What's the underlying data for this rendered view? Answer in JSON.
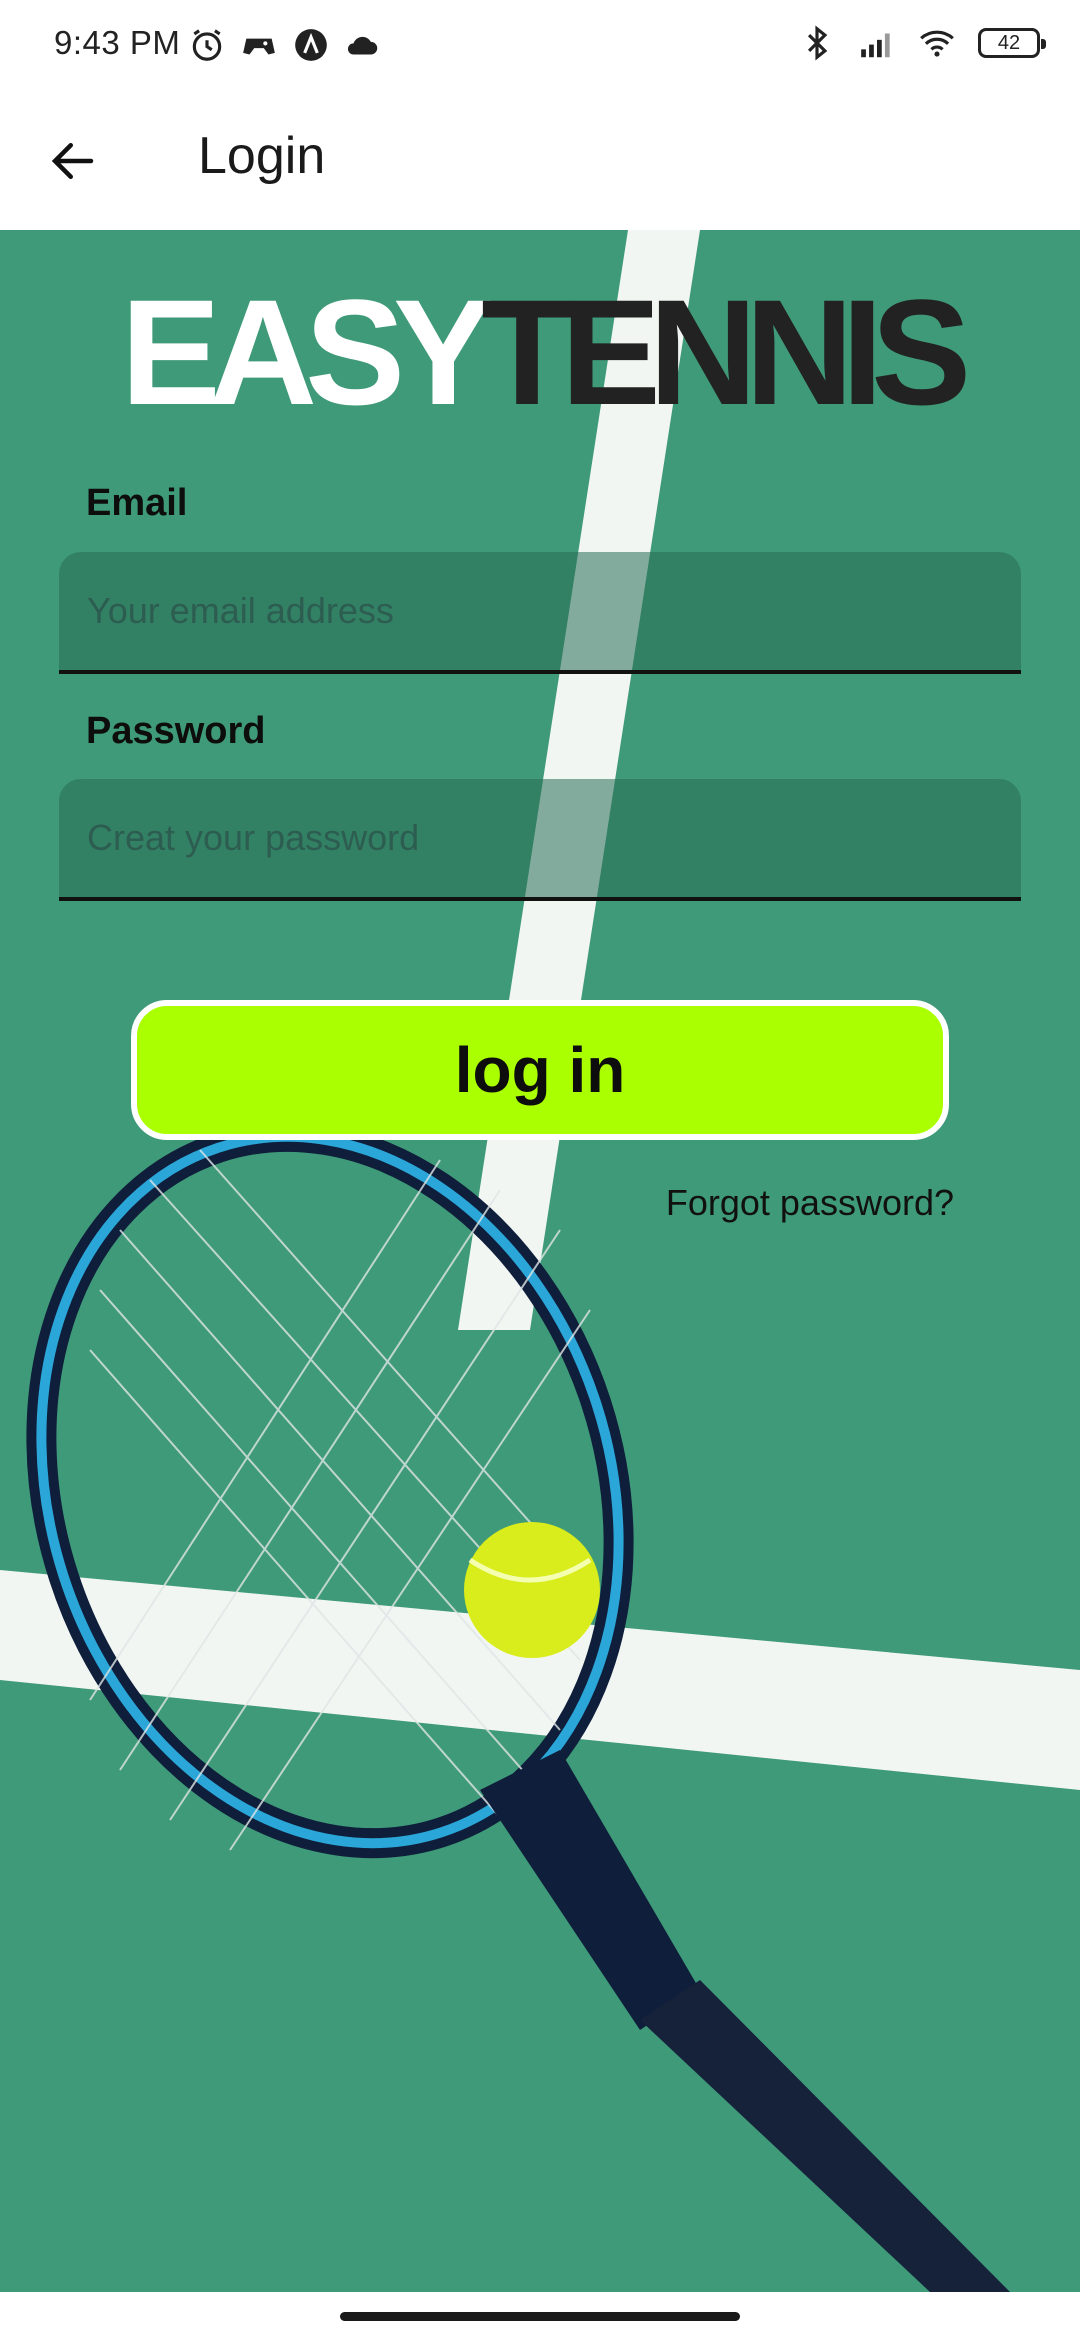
{
  "status_bar": {
    "time": "9:43 PM",
    "battery": "42",
    "icons": [
      "alarm-icon",
      "gamepad-icon",
      "app-icon",
      "cloud-icon",
      "bluetooth-icon",
      "signal-icon",
      "wifi-icon",
      "battery-icon"
    ]
  },
  "app_bar": {
    "title": "Login",
    "back_icon": "arrow-left-icon"
  },
  "logo": {
    "part1": "EASY",
    "part2": "TENNIS"
  },
  "form": {
    "email_label": "Email",
    "email_placeholder": "Your email address",
    "email_value": "",
    "password_label": "Password",
    "password_placeholder": "Creat your password",
    "password_value": "",
    "login_button": "log in",
    "forgot_link": "Forgot password?"
  },
  "colors": {
    "court": "#3f9a79",
    "button": "#aaff00",
    "line": "#f2f6f3"
  }
}
